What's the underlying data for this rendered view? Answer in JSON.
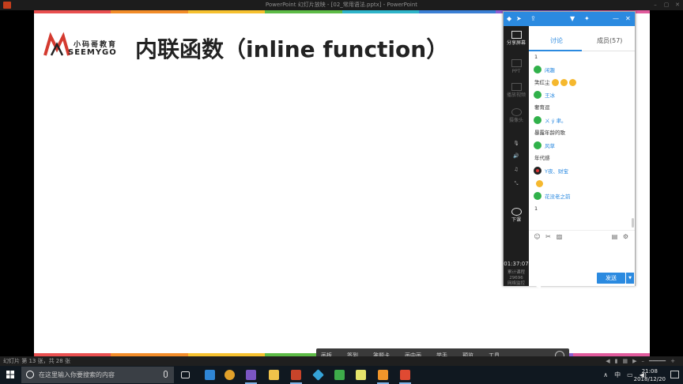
{
  "window": {
    "title": "PowerPoint 幻灯片放映 - [02_常用语法.pptx] - PowerPoint"
  },
  "colors": {
    "accent": "#2b8ae0",
    "rainbow": [
      "#e94f4f",
      "#f28c28",
      "#f6c12e",
      "#5dbb46",
      "#2fb4c9",
      "#3a7fd5",
      "#8d5fd3",
      "#e05a9c"
    ]
  },
  "slide": {
    "logo": {
      "cn": "小码哥教育",
      "en": "SEEMYGO"
    },
    "title": "内联函数（inline function）"
  },
  "status": {
    "slide_info": "幻灯片 第 13 张，共 28 张"
  },
  "presenter_toolbar": {
    "items": [
      "画板",
      "签到",
      "答题卡",
      "画中画",
      "举手",
      "预览",
      "工具"
    ]
  },
  "panel": {
    "header_icons": [
      "diamond-icon",
      "arrow-icon",
      "share-icon",
      "chevron-down-icon",
      "pin-icon",
      "minimize-icon",
      "close-icon"
    ],
    "side": {
      "share_screen": "分享屏幕",
      "ppt": "PPT",
      "play_video": "播放视频",
      "camera": "摄像头",
      "end_class": "下课",
      "timer": "01:37:07",
      "stats_label": "累计课程",
      "stats_value": "29696",
      "network": "网络监控"
    },
    "tabs": {
      "discussion": "讨论",
      "members": "成员(57)"
    },
    "chat": [
      {
        "type": "text",
        "text": "1"
      },
      {
        "type": "user",
        "name": "闲趣"
      },
      {
        "type": "text",
        "text": "笑红尘",
        "emoji": 3
      },
      {
        "type": "user",
        "name": "王冰"
      },
      {
        "type": "text",
        "text": "奢育逗"
      },
      {
        "type": "user",
        "name": "ㄨ ý 聿。"
      },
      {
        "type": "text",
        "text": "暴露年龄的歌"
      },
      {
        "type": "user",
        "name": "风草"
      },
      {
        "type": "text",
        "text": "年代感"
      },
      {
        "type": "user",
        "name": "Y夜、财宝",
        "dark": true
      },
      {
        "type": "text",
        "text": "",
        "emoji": 1
      },
      {
        "type": "user",
        "name": "花没老之前"
      },
      {
        "type": "text",
        "text": "1"
      }
    ],
    "send_label": "发送"
  },
  "taskbar": {
    "search_placeholder": "在这里输入你要搜索的内容",
    "ime": "中",
    "time": "21:08",
    "date": "2018/12/20"
  }
}
